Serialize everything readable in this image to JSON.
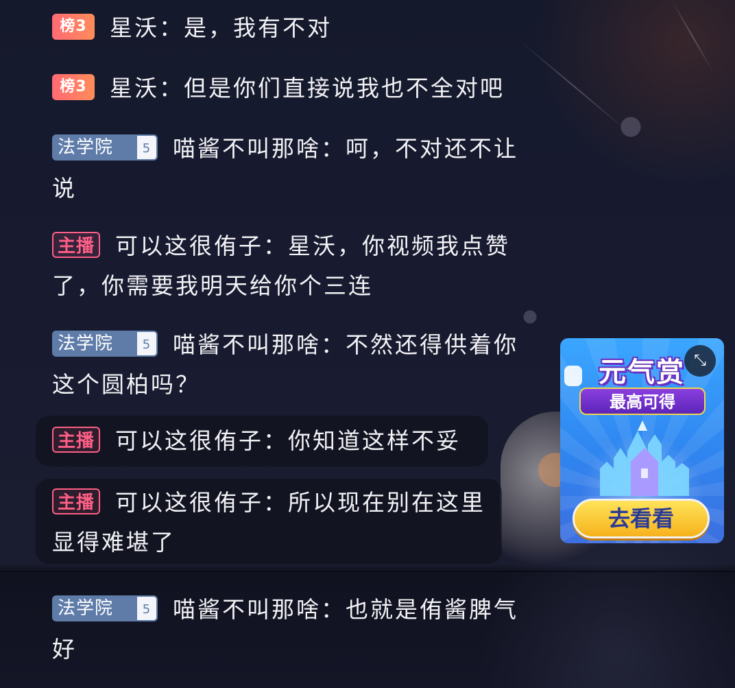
{
  "messages": [
    {
      "badge_type": "rank",
      "badge_label": "榜3",
      "user": "星沃",
      "text": "是，我有不对"
    },
    {
      "badge_type": "rank",
      "badge_label": "榜3",
      "user": "星沃",
      "text": "但是你们直接说我也不全对吧"
    },
    {
      "badge_type": "fan",
      "badge_label": "法学院",
      "badge_level": "5",
      "user": "喵酱不叫那啥",
      "text": "呵，不对还不让说"
    },
    {
      "badge_type": "host",
      "badge_label": "主播",
      "user": "可以这很侑子",
      "text": "星沃，你视频我点赞了，你需要我明天给你个三连"
    },
    {
      "badge_type": "fan",
      "badge_label": "法学院",
      "badge_level": "5",
      "user": "喵酱不叫那啥",
      "text": "不然还得供着你这个圆柏吗？"
    },
    {
      "badge_type": "host",
      "badge_label": "主播",
      "user": "可以这很侑子",
      "text": "你知道这样不妥"
    },
    {
      "badge_type": "host",
      "badge_label": "主播",
      "user": "可以这很侑子",
      "text": "所以现在别在这里显得难堪了"
    },
    {
      "badge_type": "fan",
      "badge_label": "法学院",
      "badge_level": "5",
      "user": "喵酱不叫那啥",
      "text": "也就是侑酱脾气好"
    }
  ],
  "separator": "：",
  "ad": {
    "title": "元气赏",
    "subtitle": "最高可得",
    "cta": "去看看",
    "close_icon": "shrink-arrows-icon",
    "colors": {
      "background": "#2f86f0",
      "cta": "#f6b21c",
      "subtitle_bg": "#6a2ec5"
    }
  },
  "colors": {
    "rank_badge": "#ff6a73",
    "host_badge": "#ff5f86",
    "fan_badge": "#5f7ca9",
    "text": "#f3f3f6"
  }
}
